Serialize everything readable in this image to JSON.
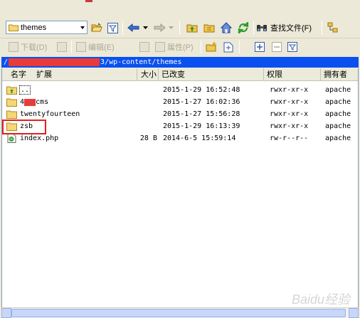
{
  "toolbar": {
    "location_combo_value": "themes",
    "find_files_label": "查找文件(F)"
  },
  "toolbar2": {
    "download_label": "下载(D)",
    "edit_label": "编辑(E)",
    "properties_label": "属性(P)"
  },
  "path": {
    "prefix": "/",
    "suffix": "3/wp-content/themes"
  },
  "columns": {
    "name": "名字",
    "ext": "扩展",
    "size": "大小",
    "modified": "已改变",
    "permissions": "权限",
    "owner": "拥有者"
  },
  "files": [
    {
      "name": "..",
      "size": "",
      "modified": "2015-1-29 16:52:48",
      "perm": "rwxr-xr-x",
      "owner": "apache",
      "icon": "parent-folder-icon"
    },
    {
      "name_prefix": "4",
      "name": "cms",
      "size": "",
      "modified": "2015-1-27 16:02:36",
      "perm": "rwxr-xr-x",
      "owner": "apache",
      "icon": "folder-icon"
    },
    {
      "name": "twentyfourteen",
      "size": "",
      "modified": "2015-1-27 15:56:28",
      "perm": "rwxr-xr-x",
      "owner": "apache",
      "icon": "folder-icon"
    },
    {
      "name": "zsb",
      "size": "",
      "modified": "2015-1-29 16:13:39",
      "perm": "rwxr-xr-x",
      "owner": "apache",
      "icon": "folder-icon"
    },
    {
      "name": "index.php",
      "size": "28 B",
      "modified": "2014-6-5 15:59:14",
      "perm": "rw-r--r--",
      "owner": "apache",
      "icon": "php-file-icon"
    }
  ],
  "watermark": "Baidu经验",
  "colors": {
    "path_bar": "#0a50f0",
    "highlight": "#e02020",
    "redaction": "#e83b3b"
  }
}
